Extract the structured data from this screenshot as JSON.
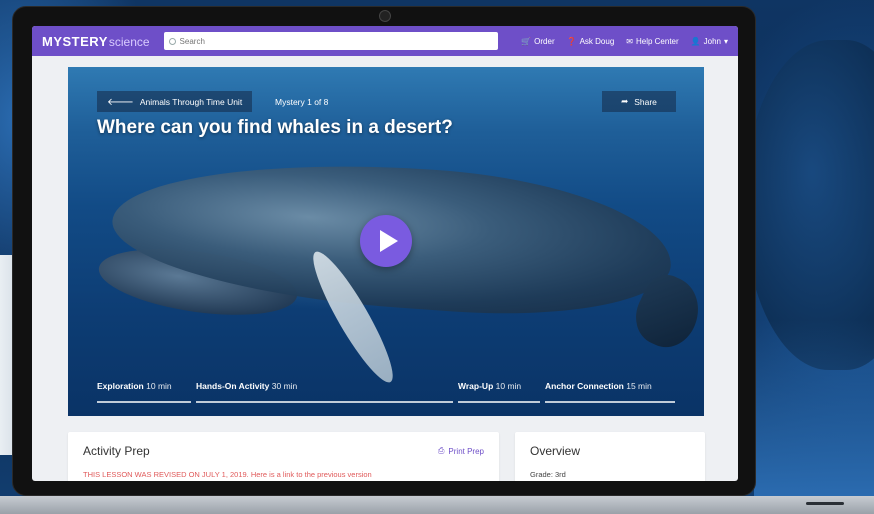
{
  "nav": {
    "logo_bold": "MYSTERY",
    "logo_light": "science",
    "search_placeholder": "Search",
    "links": [
      {
        "label": "Order",
        "icon": "cart-icon"
      },
      {
        "label": "Ask Doug",
        "icon": "question-icon"
      },
      {
        "label": "Help Center",
        "icon": "mail-icon"
      },
      {
        "label": "John",
        "icon": "user-icon"
      }
    ]
  },
  "hero": {
    "breadcrumb": "Animals Through Time Unit",
    "mystery_count": "Mystery 1 of 8",
    "share_label": "Share",
    "title": "Where can you find whales in a desert?",
    "segments": [
      {
        "label": "Exploration",
        "minutes": "10 min"
      },
      {
        "label": "Hands-On Activity",
        "minutes": "30 min"
      },
      {
        "label": "Wrap-Up",
        "minutes": "10 min"
      },
      {
        "label": "Anchor Connection",
        "minutes": "15 min"
      }
    ]
  },
  "activity_prep": {
    "heading": "Activity Prep",
    "print_label": "Print Prep",
    "revised_note": "THIS LESSON WAS REVISED ON JULY 1, 2019. Here is a link to the previous version"
  },
  "overview": {
    "heading": "Overview",
    "grade": "Grade: 3rd"
  },
  "colors": {
    "brand_purple": "#6e4fc8",
    "play_purple": "#7a5be0",
    "revised_red": "#e05a5a"
  }
}
